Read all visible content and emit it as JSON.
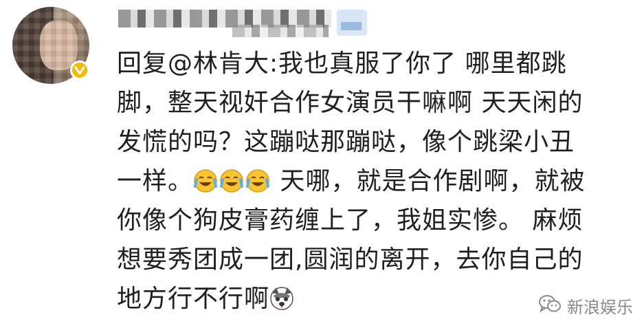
{
  "comment": {
    "lines": [
      {
        "prefix": "回复",
        "mention": "@林肯大",
        "text": ":我也真服了你了 哪里都跳"
      },
      {
        "text": "脚，整天视奸合作女演员干嘛啊 天天闲的"
      },
      {
        "text": "发慌的吗？这蹦哒那蹦哒，像个跳梁小丑"
      },
      {
        "text_before": "一样。",
        "emoji_name": "laugh-cry-icon",
        "text_after": " 天哪，就是合作剧啊，就被"
      },
      {
        "text": "你像个狗皮膏药缠上了，我姐实惨。 麻烦"
      },
      {
        "text": "想要秀团成一团,圆润的离开，去你自己的"
      },
      {
        "text": "地方行不行啊"
      }
    ]
  },
  "watermark": {
    "text": "新浪娱乐",
    "icon": "wechat-icon"
  },
  "colors": {
    "text": "#1f1f1f",
    "badge": "#f5b800",
    "watermark": "#8a8a8a"
  }
}
